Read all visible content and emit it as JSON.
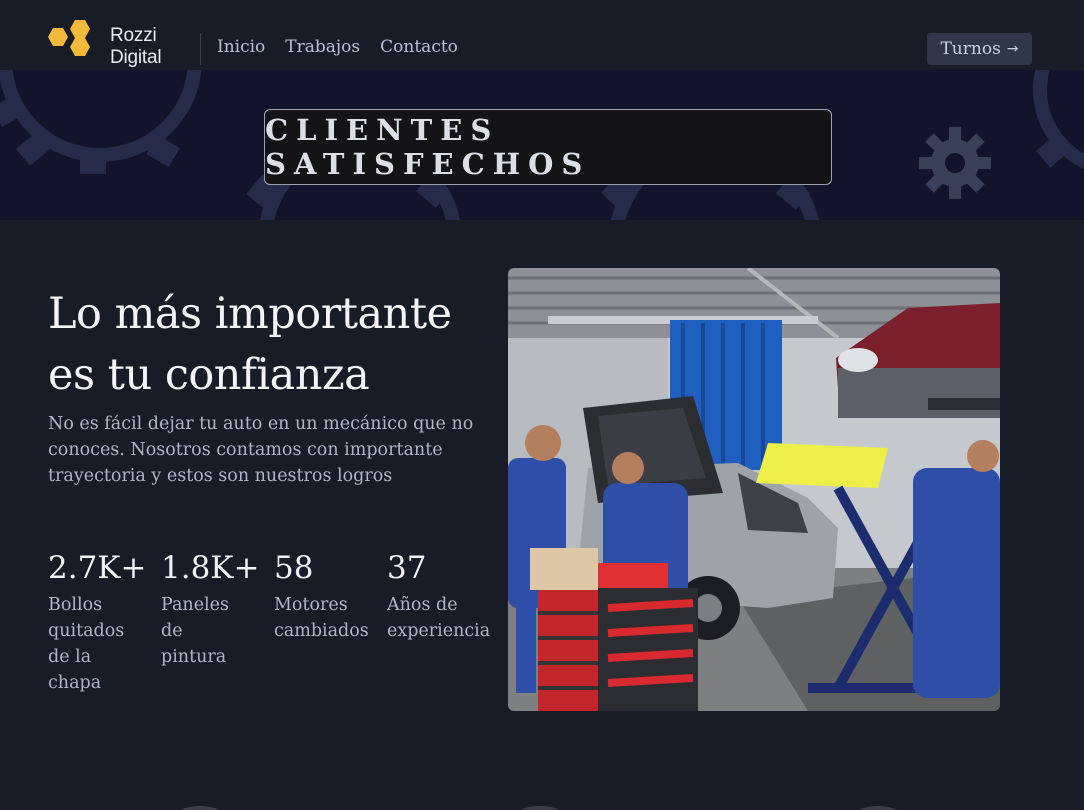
{
  "nav": {
    "logo_line1": "Rozzi",
    "logo_line2": "Digital",
    "links": [
      "Inicio",
      "Trabajos",
      "Contacto"
    ],
    "cta_label": "Turnos",
    "cta_icon": "arrow-right-icon"
  },
  "banner": {
    "title": "CLIENTES SATISFECHOS"
  },
  "hero": {
    "headline": "Lo más importante es tu confianza",
    "lead": "No es fácil dejar tu auto en un mecánico que no conoces. Nosotros contamos con importante trayectoria y estos son nuestros logros"
  },
  "stats": [
    {
      "value": "2.7K+",
      "label": "Bollos quitados de la chapa"
    },
    {
      "value": "1.8K+",
      "label": "Paneles de pintura"
    },
    {
      "value": "58",
      "label": "Motores cambiados"
    },
    {
      "value": "37",
      "label": "Años de experiencia"
    }
  ],
  "colors": {
    "background": "#181c27",
    "banner_bg": "#11142a",
    "logo_accent": "#f4b93a",
    "cta_bg": "#2f3749"
  }
}
